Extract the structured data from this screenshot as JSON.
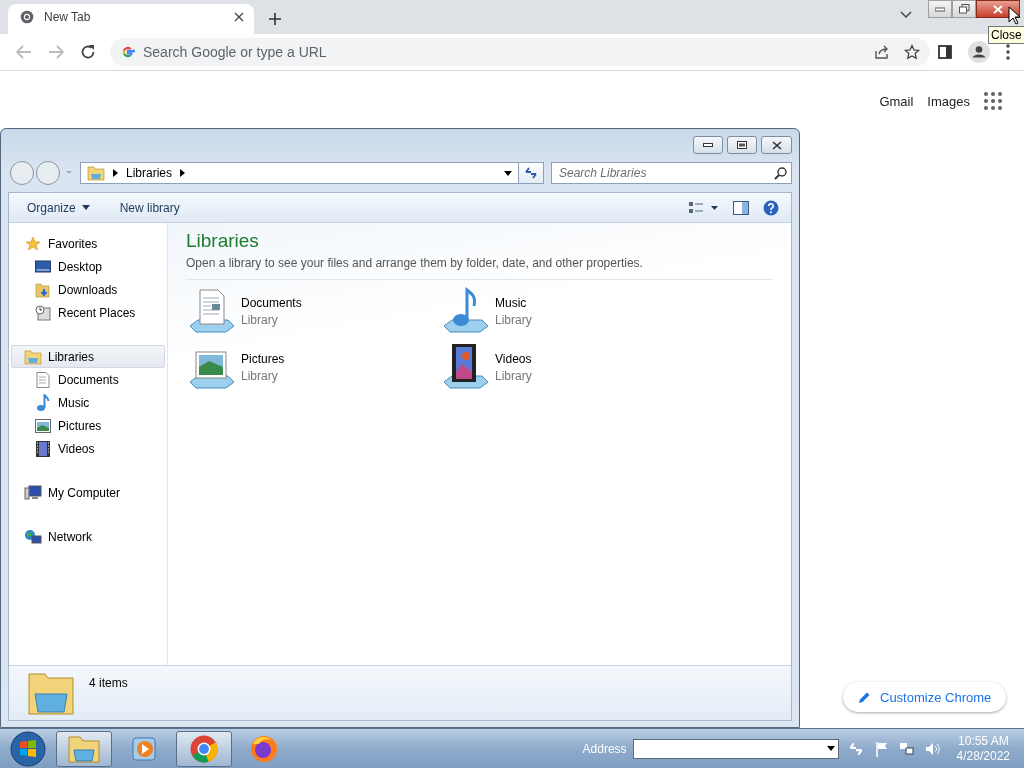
{
  "browser": {
    "tabs": [
      {
        "title": "New Tab",
        "selected": true
      }
    ],
    "tooltip": "Close",
    "omnibox": {
      "placeholder": "Search Google or type a URL"
    },
    "header_links": [
      "Gmail",
      "Images"
    ],
    "customize_button": "Customize Chrome"
  },
  "explorer": {
    "breadcrumb": [
      "Libraries"
    ],
    "search": {
      "placeholder": "Search Libraries"
    },
    "toolbar": [
      {
        "label": "Organize",
        "menu": true
      },
      {
        "label": "New library",
        "menu": false
      }
    ],
    "nav": [
      {
        "label": "Favorites",
        "selected": false,
        "children": [
          {
            "label": "Desktop",
            "selected": false
          },
          {
            "label": "Downloads",
            "selected": false
          },
          {
            "label": "Recent Places",
            "selected": false
          }
        ]
      },
      {
        "label": "Libraries",
        "selected": true,
        "children": [
          {
            "label": "Documents",
            "selected": false
          },
          {
            "label": "Music",
            "selected": false
          },
          {
            "label": "Pictures",
            "selected": false
          },
          {
            "label": "Videos",
            "selected": false
          }
        ]
      },
      {
        "label": "My Computer",
        "selected": false
      },
      {
        "label": "Network",
        "selected": false
      }
    ],
    "heading": "Libraries",
    "description": "Open a library to see your files and arrange them by folder, date, and other properties.",
    "libraries": [
      {
        "name": "Documents",
        "type": "Library"
      },
      {
        "name": "Music",
        "type": "Library"
      },
      {
        "name": "Pictures",
        "type": "Library"
      },
      {
        "name": "Videos",
        "type": "Library"
      }
    ],
    "status": "4 items"
  },
  "taskbar": {
    "apps": [
      {
        "selected": true
      },
      {
        "selected": false
      },
      {
        "selected": true
      },
      {
        "selected": false
      }
    ],
    "address_label": "Address",
    "time": "10:55 AM",
    "date": "4/28/2022"
  }
}
